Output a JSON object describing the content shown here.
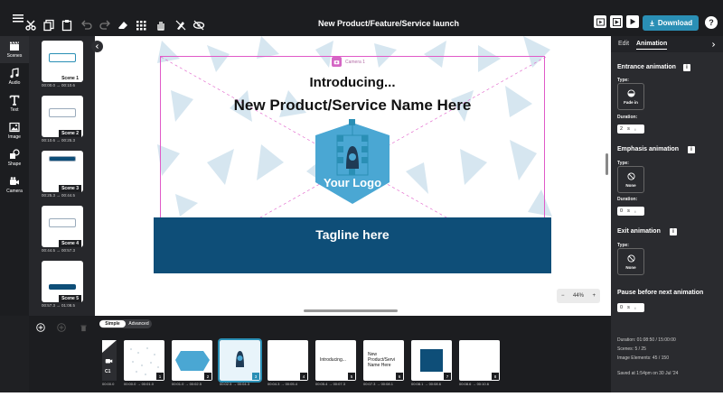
{
  "header": {
    "title": "New Product/Feature/Service launch",
    "download_label": "Download",
    "help_label": "?"
  },
  "rail": {
    "scenes": "Scenes",
    "audio": "Audio",
    "text": "Text",
    "image": "Image",
    "shape": "Shape",
    "camera": "Camera"
  },
  "scenes": [
    {
      "label": "Scene 1",
      "time": "00:00.0  →  00:10.6"
    },
    {
      "label": "Scene 2",
      "time": "00:10.6  →  00:25.3"
    },
    {
      "label": "Scene 3",
      "time": "00:25.3  →  00:44.5"
    },
    {
      "label": "Scene 4",
      "time": "00:44.5  →  00:57.3"
    },
    {
      "label": "Scene 5",
      "time": "00:57.3  →  01:08.5"
    }
  ],
  "canvas": {
    "camera_label": "Camera 1",
    "intro_text": "Introducing...",
    "product_text": "New Product/Service Name Here",
    "logo_text": "Your Logo",
    "tagline_text": "Tagline here",
    "zoom_value": "44%",
    "zoom_minus": "−",
    "zoom_plus": "+"
  },
  "panel": {
    "tab_edit": "Edit",
    "tab_animation": "Animation",
    "entrance": {
      "heading": "Entrance animation",
      "type_label": "Type:",
      "type_value": "Fade in",
      "duration_label": "Duration:",
      "duration_value": "2",
      "unit": "s"
    },
    "emphasis": {
      "heading": "Emphasis animation",
      "type_label": "Type:",
      "type_value": "None",
      "duration_label": "Duration:",
      "duration_value": "0",
      "unit": "s"
    },
    "exit": {
      "heading": "Exit animation",
      "type_label": "Type:",
      "type_value": "None"
    },
    "pause": {
      "heading": "Pause before next animation",
      "value": "0",
      "unit": "s"
    },
    "info": "i",
    "stats": {
      "duration": "Duration: 01:08:50 / 15:00:00",
      "scenes": "Scenes: 5 / 25",
      "image_elements": "Image Elements: 45 / 150",
      "saved": "Saved at 1:54pm on 30 Jul '24"
    }
  },
  "timeline": {
    "mode_simple": "Simple",
    "mode_advanced": "Advanced",
    "camera_clip": "C1",
    "camera_time": "00:00.0",
    "clips": [
      {
        "num": "1",
        "time": "00:00.0  →  00:01.0",
        "thumb": "pattern"
      },
      {
        "num": "2",
        "time": "00:01.0  →  00:02.5",
        "thumb": "hexagon"
      },
      {
        "num": "3",
        "time": "00:02.5  →  00:04.3",
        "thumb": "logo"
      },
      {
        "num": "4",
        "time": "00:04.3  →  00:05.4",
        "thumb": "blank"
      },
      {
        "num": "5",
        "time": "00:05.4  →  00:07.3",
        "thumb": "intro",
        "text": "Introducing..."
      },
      {
        "num": "6",
        "time": "00:07.3  →  00:08.1",
        "thumb": "name",
        "text": "New Product/Servi Name Here"
      },
      {
        "num": "7",
        "time": "00:08.1  →  00:08.6",
        "thumb": "square"
      },
      {
        "num": "8",
        "time": "00:08.6  →  00:10.6",
        "thumb": "blank"
      }
    ]
  },
  "colors": {
    "accent": "#2a8fb5",
    "tagline_bar": "#0e4e78",
    "logo_blue": "#4aa7d3",
    "camera_frame": "#e05ac8"
  }
}
